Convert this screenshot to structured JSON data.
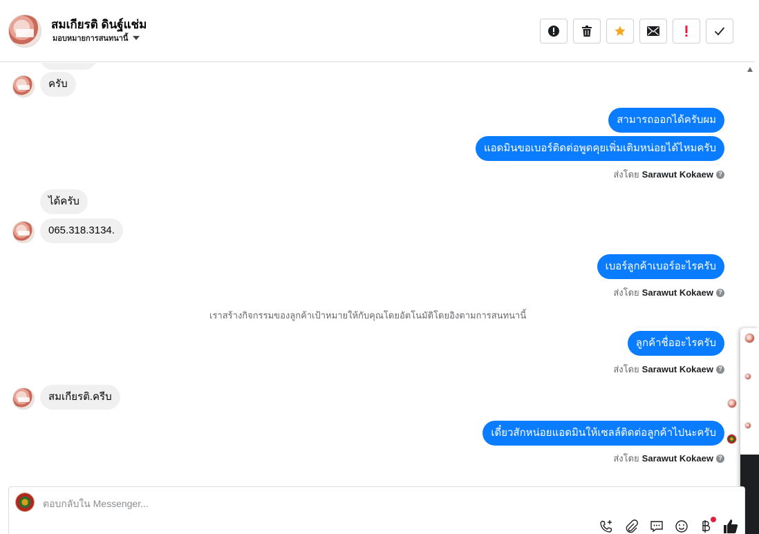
{
  "header": {
    "contact_name": "สมเกียรติ ดินฐ์แช่ม",
    "assign_label": "มอบหมายการสนทนานี้"
  },
  "toolbar": {
    "items": [
      "report-spam",
      "delete",
      "star",
      "mark-unread",
      "follow-up",
      "mark-done"
    ]
  },
  "messages": [
    {
      "side": "in",
      "text": "ครับ"
    },
    {
      "side": "out",
      "text": "สามารถออกได้ครับผม"
    },
    {
      "side": "out",
      "text": "แอดมินขอเบอร์ติดต่อพูดคุยเพิ่มเติมหน่อยได้ไหมครับ"
    },
    {
      "side": "in",
      "text": "ได้ครับ"
    },
    {
      "side": "in",
      "text": "065.318.3134."
    },
    {
      "side": "out",
      "text": "เบอร์ลูกค้าเบอร์อะไรครับ"
    },
    {
      "side": "out",
      "text": "ลูกค้าชื่ออะไรครับ"
    },
    {
      "side": "in",
      "text": "สมเกียรติ.ครีบ"
    },
    {
      "side": "out",
      "text": "เดี๋ยวสักหน่อยแอดมินให้เซลล์ติดต่อลูกค้าไปนะครับ"
    }
  ],
  "sent_by": {
    "prefix": "ส่งโดย",
    "name": "Sarawut Kokaew"
  },
  "system_note": "เราสร้างกิจกรรมของลูกค้าเป้าหมายให้กับคุณโดยอัตโนมัติโดยอิงตามการสนทนานี้",
  "composer": {
    "placeholder": "ตอบกลับใน Messenger..."
  },
  "colors": {
    "outgoing_bubble": "#0a7cff",
    "incoming_bubble": "#f0f0f0",
    "star": "#f5a623",
    "follow_up": "#e41e3f"
  }
}
